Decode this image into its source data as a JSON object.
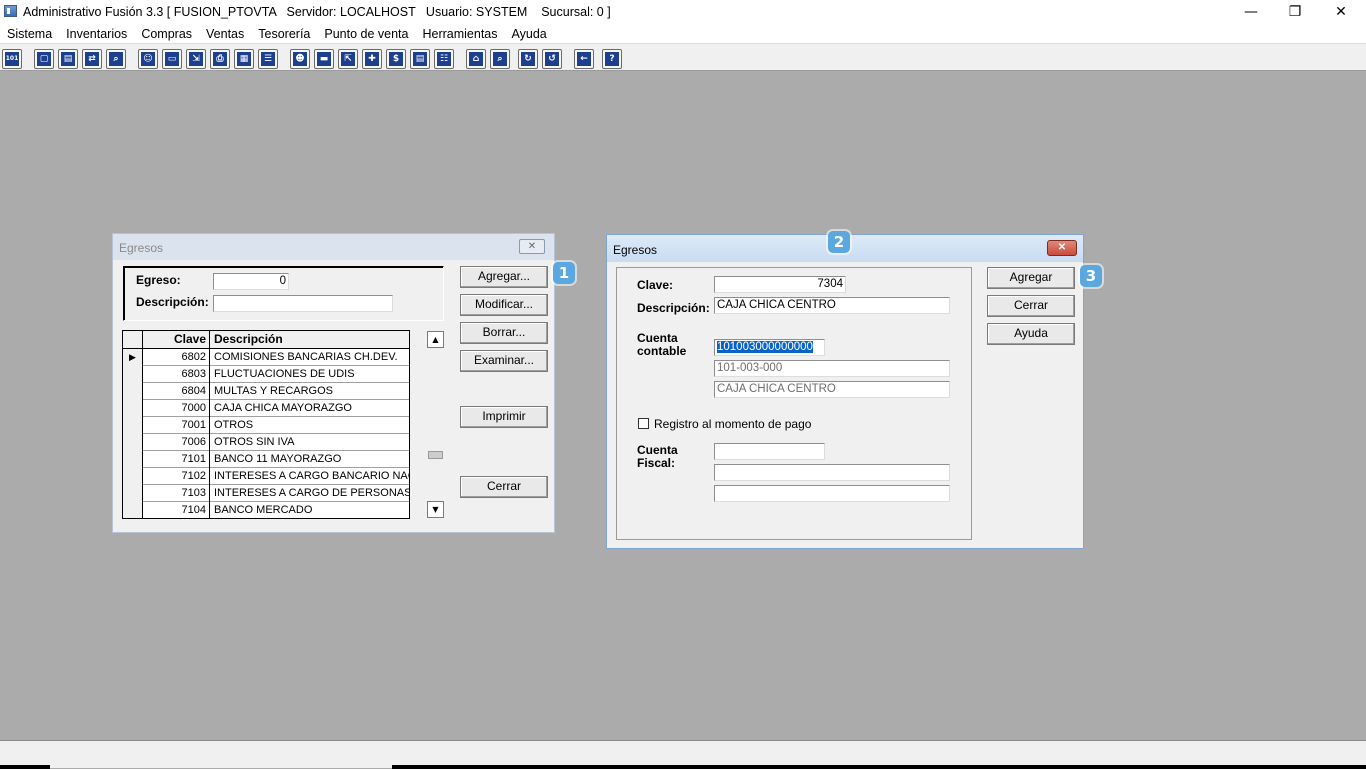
{
  "window": {
    "title": "Administrativo Fusión 3.3 [ FUSION_PTOVTA   Servidor: LOCALHOST   Usuario: SYSTEM    Sucursal: 0 ]",
    "minimize_glyph": "—",
    "maximize_glyph": "❐",
    "close_glyph": "✕"
  },
  "menu": [
    "Sistema",
    "Inventarios",
    "Compras",
    "Ventas",
    "Tesorería",
    "Punto de venta",
    "Herramientas",
    "Ayuda"
  ],
  "toolbar": {
    "buttons": [
      {
        "name": "calculator-icon",
        "glyph": "101"
      },
      {
        "name": "copy-icon",
        "glyph": "▢"
      },
      {
        "name": "clipboard-icon",
        "glyph": "▤"
      },
      {
        "name": "transfer-icon",
        "glyph": "⇄"
      },
      {
        "name": "zoom-icon",
        "glyph": "⌕"
      },
      {
        "name": "user-icon",
        "glyph": "☺"
      },
      {
        "name": "folder-icon",
        "glyph": "▭"
      },
      {
        "name": "import-icon",
        "glyph": "⇲"
      },
      {
        "name": "print-icon",
        "glyph": "⎙"
      },
      {
        "name": "document-icon",
        "glyph": "▦"
      },
      {
        "name": "list-icon",
        "glyph": "☰"
      },
      {
        "name": "users-icon",
        "glyph": "☻"
      },
      {
        "name": "card-icon",
        "glyph": "▬"
      },
      {
        "name": "export-icon",
        "glyph": "⇱"
      },
      {
        "name": "add-icon",
        "glyph": "✚"
      },
      {
        "name": "dollar-icon",
        "glyph": "$"
      },
      {
        "name": "report-icon",
        "glyph": "▤"
      },
      {
        "name": "table-icon",
        "glyph": "☷"
      },
      {
        "name": "home-icon",
        "glyph": "⌂"
      },
      {
        "name": "search-icon",
        "glyph": "⌕"
      },
      {
        "name": "refresh-icon",
        "glyph": "↻"
      },
      {
        "name": "undo-icon",
        "glyph": "↺"
      },
      {
        "name": "back-arrow-icon",
        "glyph": "←"
      },
      {
        "name": "help-icon",
        "glyph": "?"
      }
    ]
  },
  "dlg1": {
    "title": "Egresos",
    "close_glyph": "✕",
    "egreso_label": "Egreso:",
    "egreso_value": "0",
    "descripcion_label": "Descripción:",
    "descripcion_value": "",
    "buttons": {
      "agregar": "Agregar...",
      "modificar": "Modificar...",
      "borrar": "Borrar...",
      "examinar": "Examinar...",
      "imprimir": "Imprimir",
      "cerrar": "Cerrar"
    },
    "grid": {
      "col_clave": "Clave",
      "col_desc": "Descripción",
      "current_marker": "▶",
      "rows": [
        {
          "clave": "6802",
          "desc": "COMISIONES BANCARIAS CH.DEV."
        },
        {
          "clave": "6803",
          "desc": "FLUCTUACIONES DE UDIS"
        },
        {
          "clave": "6804",
          "desc": "MULTAS Y RECARGOS"
        },
        {
          "clave": "7000",
          "desc": "CAJA CHICA MAYORAZGO"
        },
        {
          "clave": "7001",
          "desc": "OTROS"
        },
        {
          "clave": "7006",
          "desc": "OTROS SIN IVA"
        },
        {
          "clave": "7101",
          "desc": "BANCO 11 MAYORAZGO"
        },
        {
          "clave": "7102",
          "desc": "INTERESES A CARGO BANCARIO NACIO"
        },
        {
          "clave": "7103",
          "desc": "INTERESES A CARGO DE PERSONAS FIS"
        },
        {
          "clave": "7104",
          "desc": "BANCO MERCADO"
        }
      ]
    },
    "scroll_up": "▲",
    "scroll_down": "▼",
    "badge": "1"
  },
  "dlg2": {
    "title": "Egresos",
    "close_glyph": "✕",
    "clave_label": "Clave:",
    "clave_value": "7304",
    "descripcion_label": "Descripción:",
    "descripcion_value": "CAJA CHICA CENTRO",
    "cuenta_contable_label_1": "Cuenta",
    "cuenta_contable_label_2": "contable",
    "cuenta_contable_value": "101003000000000",
    "cuenta_formatted": "101-003-000",
    "cuenta_nombre": "CAJA CHICA CENTRO",
    "registro_label": "Registro al momento de pago",
    "cuenta_fiscal_label_1": "Cuenta",
    "cuenta_fiscal_label_2": "Fiscal:",
    "cuenta_fiscal_value": "",
    "fiscal_line2": "",
    "fiscal_line3": "",
    "buttons": {
      "agregar": "Agregar",
      "cerrar": "Cerrar",
      "ayuda": "Ayuda"
    },
    "badge_title": "2",
    "badge_agregar": "3"
  },
  "colors": {
    "desktop": "#ababab",
    "badge": "#5aa8df",
    "close_red": "#c94b3b",
    "selection": "#0a64c8"
  }
}
